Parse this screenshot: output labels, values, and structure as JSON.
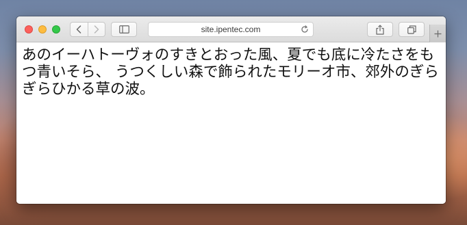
{
  "window": {
    "address_bar": {
      "url": "site.ipentec.com"
    }
  },
  "icons": {
    "traffic_lights": [
      "close-icon",
      "minimize-icon",
      "zoom-icon"
    ],
    "navigation": [
      "back-icon",
      "forward-icon"
    ],
    "toolbar": [
      "sidebar-icon",
      "reload-icon",
      "share-icon",
      "tabs-overview-icon",
      "new-tab-icon"
    ]
  },
  "colors": {
    "close": "#fc605c",
    "minimize": "#fdbc40",
    "zoom": "#34c84a"
  },
  "page": {
    "body_text": "あのイーハトーヴォのすきとおった風、夏でも底に冷たさをもつ青いそら、 うつくしい森で飾られたモリーオ市、郊外のぎらぎらひかる草の波。"
  }
}
